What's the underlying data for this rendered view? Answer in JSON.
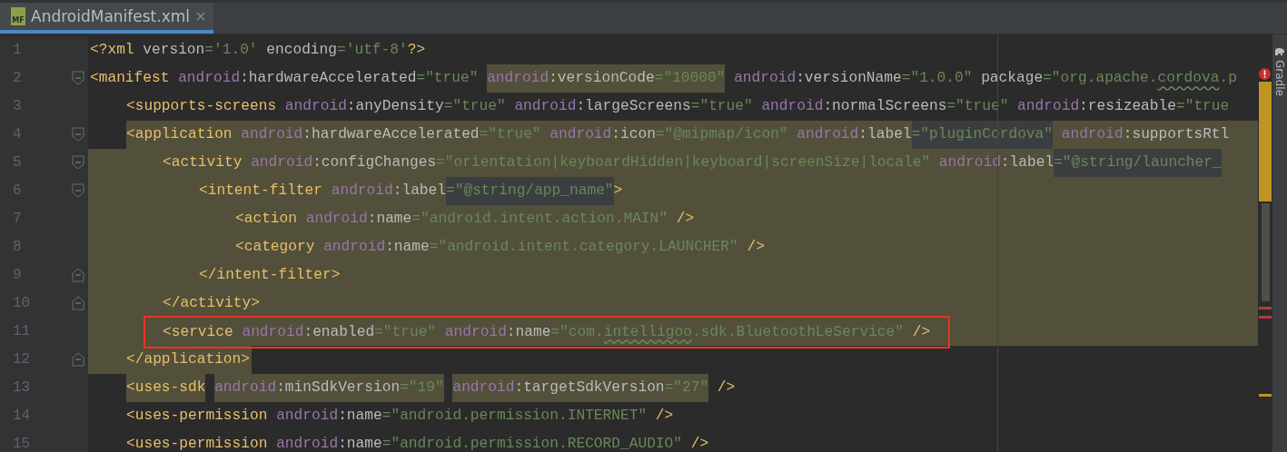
{
  "tabs": [
    {
      "label": "AndroidManifest.xml",
      "selected": true,
      "icon_label": "MF"
    }
  ],
  "side_panel": {
    "label": "Gradle"
  },
  "lines": [
    {
      "number": "1",
      "open": "<?xml",
      "attrs": [
        {
          "name": "version",
          "value": "='1.0'"
        },
        {
          "name": "encoding",
          "value": "='utf-8'"
        }
      ],
      "close": "?>"
    },
    {
      "number": "2",
      "fold_start": true,
      "open": "<manifest",
      "attrs": [
        {
          "ns": "android",
          "name": ":hardwareAccelerated",
          "value": "=\"true\""
        },
        {
          "ns": "android",
          "name": ":versionCode",
          "value": "=\"10000\"",
          "highlighted": true
        },
        {
          "ns": "android",
          "name": ":versionName",
          "value": "=\"1.0.0\""
        },
        {
          "name": "package",
          "value": [
            {
              "text": "=\"org.apache.",
              "typo": false
            },
            {
              "text": "cordova",
              "typo": true
            },
            {
              "text": ".p",
              "typo": false
            }
          ]
        }
      ],
      "children": [
        {
          "number": "3",
          "open": "<supports-screens",
          "attrs": [
            {
              "ns": "android",
              "name": ":anyDensity",
              "value": "=\"true\""
            },
            {
              "ns": "android",
              "name": ":largeScreens",
              "value": "=\"true\""
            },
            {
              "ns": "android",
              "name": ":normalScreens",
              "value": "=\"true\""
            },
            {
              "ns": "android",
              "name": ":resizeable",
              "value": "=\"true"
            }
          ]
        },
        {
          "number": "4",
          "fold_start": true,
          "in_scope": true,
          "scope_start": true,
          "open": "<application",
          "attrs": [
            {
              "ns": "android",
              "name": ":hardwareAccelerated",
              "value": "=\"true\""
            },
            {
              "ns": "android",
              "name": ":icon",
              "value": "=\"@mipmap/icon\""
            },
            {
              "ns": "android",
              "name": ":label",
              "value": "=\"pluginCordova\"",
              "value_matched": true
            },
            {
              "ns": "android",
              "name": ":supportsRtl"
            }
          ],
          "children": [
            {
              "number": "5",
              "fold_start": true,
              "in_scope": true,
              "open": "<activity",
              "attrs": [
                {
                  "ns": "android",
                  "name": ":configChanges",
                  "value": "=\"orientation|keyboardHidden|keyboard|screenSize|locale\""
                },
                {
                  "ns": "android",
                  "name": ":label",
                  "value": "=\"@string/launcher_",
                  "value_matched": true
                }
              ],
              "children": [
                {
                  "number": "6",
                  "fold_start": true,
                  "in_scope": true,
                  "open": "<intent-filter",
                  "attrs": [
                    {
                      "ns": "android",
                      "name": ":label",
                      "value": "=\"@string/app_name\"",
                      "value_matched": true
                    }
                  ],
                  "close": ">",
                  "children": [
                    {
                      "number": "7",
                      "in_scope": true,
                      "open": "<action",
                      "attrs": [
                        {
                          "ns": "android",
                          "name": ":name",
                          "value": "=\"android.intent.action.MAIN\""
                        }
                      ],
                      "close": " />"
                    },
                    {
                      "number": "8",
                      "in_scope": true,
                      "open": "<category",
                      "attrs": [
                        {
                          "ns": "android",
                          "name": ":name",
                          "value": "=\"android.intent.category.LAUNCHER\""
                        }
                      ],
                      "close": " />"
                    }
                  ]
                },
                {
                  "number": "9",
                  "fold_end": true,
                  "in_scope": true,
                  "open": "</intent-filter>"
                }
              ]
            },
            {
              "number": "10",
              "fold_end": true,
              "in_scope": true,
              "open": "</activity>"
            },
            {
              "number": "11",
              "in_scope": true,
              "boxed": true,
              "open": "<service",
              "attrs": [
                {
                  "ns": "android",
                  "name": ":enabled",
                  "value": "=\"true\""
                },
                {
                  "ns": "android",
                  "name": ":name",
                  "value": [
                    {
                      "text": "=\"com.",
                      "typo": false
                    },
                    {
                      "text": "intelligoo",
                      "typo": true
                    },
                    {
                      "text": ".sdk.BluetoothLeService\"",
                      "typo": false
                    }
                  ]
                }
              ],
              "close": " />"
            }
          ]
        },
        {
          "number": "12",
          "fold_end": true,
          "in_scope": true,
          "scope_end": true,
          "open": "</application>"
        },
        {
          "number": "13",
          "open": "<uses-sdk",
          "tag_highlighted": true,
          "attrs": [
            {
              "ns": "android",
              "name": ":minSdkVersion",
              "value": "=\"19\"",
              "highlighted": true
            },
            {
              "ns": "android",
              "name": ":targetSdkVersion",
              "value": "=\"27\"",
              "highlighted": true
            }
          ],
          "close": " />"
        },
        {
          "number": "14",
          "open": "<uses-permission",
          "attrs": [
            {
              "ns": "android",
              "name": ":name",
              "value": "=\"android.permission.INTERNET\""
            }
          ],
          "close": " />"
        },
        {
          "number": "15",
          "open": "<uses-permission",
          "attrs": [
            {
              "ns": "android",
              "name": ":name",
              "value": "=\"android.permission.RECORD_AUDIO\""
            }
          ],
          "close": " />"
        }
      ]
    }
  ]
}
